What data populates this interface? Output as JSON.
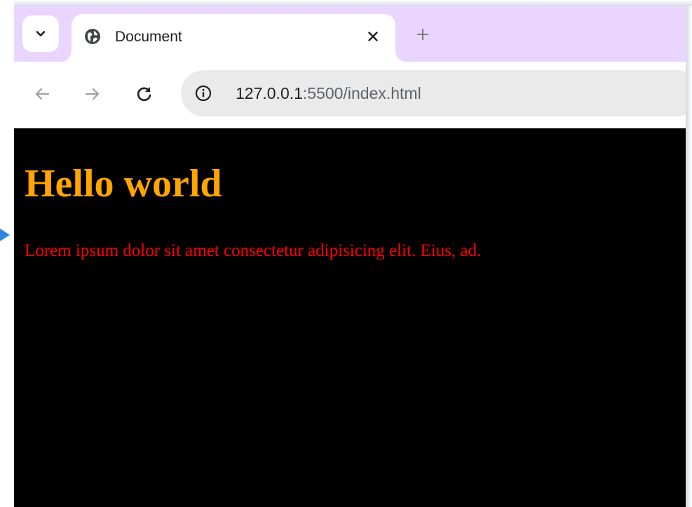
{
  "browser": {
    "tab_title": "Document",
    "close_tab_glyph": "✕",
    "new_tab_glyph": "+",
    "url_host": "127.0.0.1",
    "url_rest": ":5500/index.html",
    "icons": {
      "tab_search": "chevron-down-icon",
      "favicon": "globe-icon",
      "back": "back-arrow-icon",
      "forward": "forward-arrow-icon",
      "reload": "reload-icon",
      "site_info": "info-icon"
    },
    "colors": {
      "tabstrip": "#ead5ff",
      "omnibox": "#eaeaea"
    }
  },
  "page": {
    "heading": "Hello world",
    "paragraph": "Lorem ipsum dolor sit amet consectetur adipisicing elit. Eius, ad.",
    "colors": {
      "background": "#000000",
      "heading": "#ffa500",
      "paragraph": "#ff0000"
    }
  }
}
